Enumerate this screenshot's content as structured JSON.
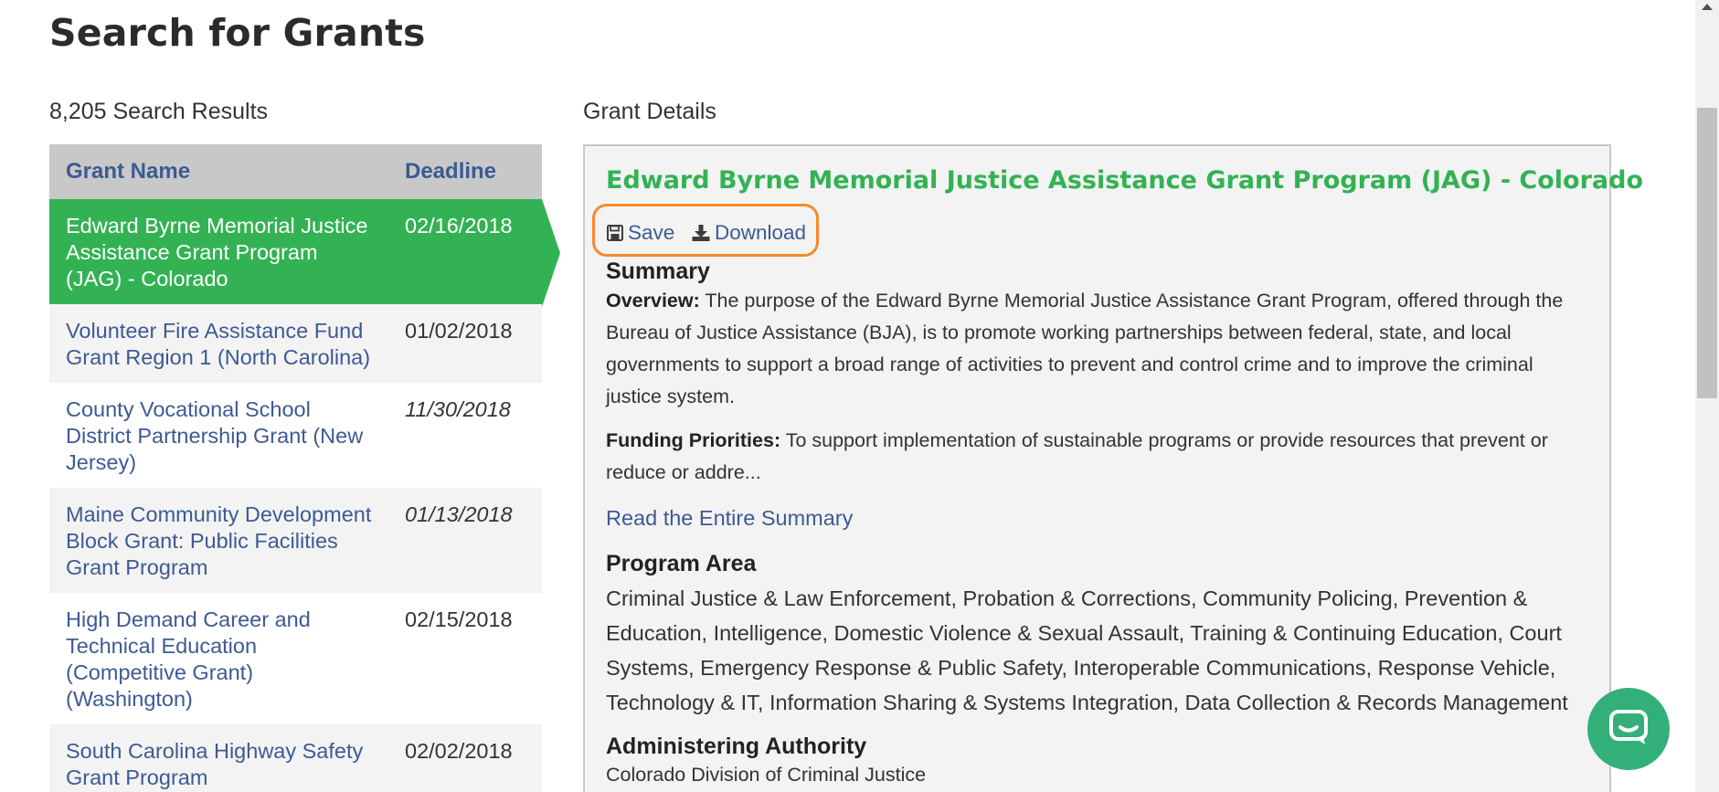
{
  "page": {
    "title": "Search for Grants",
    "results_count": "8,205 Search Results",
    "details_heading": "Grant Details"
  },
  "table": {
    "headers": {
      "name": "Grant Name",
      "deadline": "Deadline"
    },
    "rows": [
      {
        "name": "Edward Byrne Memorial Justice Assistance Grant Program (JAG) - Colorado",
        "deadline": "02/16/2018"
      },
      {
        "name": "Volunteer Fire Assistance Fund Grant Region 1 (North Carolina)",
        "deadline": "01/02/2018"
      },
      {
        "name": "County Vocational School District Partnership Grant (New Jersey)",
        "deadline": "11/30/2018"
      },
      {
        "name": "Maine Community Development Block Grant: Public Facilities Grant Program",
        "deadline": "01/13/2018"
      },
      {
        "name": "High Demand Career and Technical Education (Competitive Grant) (Washington)",
        "deadline": "02/15/2018"
      },
      {
        "name": "South Carolina Highway Safety Grant Program",
        "deadline": "02/02/2018"
      }
    ]
  },
  "details": {
    "title": "Edward Byrne Memorial Justice Assistance Grant Program (JAG) - Colorado",
    "actions": {
      "save": "Save",
      "download": "Download"
    },
    "summary_heading": "Summary",
    "overview_label": "Overview:",
    "overview_text": " The purpose of the Edward Byrne Memorial Justice Assistance Grant Program, offered through the Bureau of Justice Assistance (BJA), is to promote working partnerships between federal, state, and local governments to support a broad range of activities to prevent and control crime and to improve the criminal justice system.",
    "funding_label": "Funding Priorities:",
    "funding_text": " To support implementation of sustainable programs or provide resources that prevent or reduce or addre...",
    "read_more": "Read the Entire Summary",
    "program_area_heading": "Program Area",
    "program_area_text": "Criminal Justice & Law Enforcement, Probation & Corrections, Community Policing, Prevention & Education, Intelligence, Domestic Violence & Sexual Assault, Training & Continuing Education, Court Systems, Emergency Response & Public Safety, Interoperable Communications, Response Vehicle, Technology & IT, Information Sharing & Systems Integration, Data Collection & Records Management",
    "authority_heading": "Administering Authority",
    "authority_text": "Colorado Division of Criminal Justice"
  },
  "colors": {
    "accent_green": "#33b253",
    "link_blue": "#3d5a93",
    "highlight_orange": "#f58a2b",
    "chat_green": "#33b07a"
  },
  "icons": [
    "save-icon",
    "download-icon",
    "chat-icon",
    "scroll-up-arrow-icon"
  ]
}
